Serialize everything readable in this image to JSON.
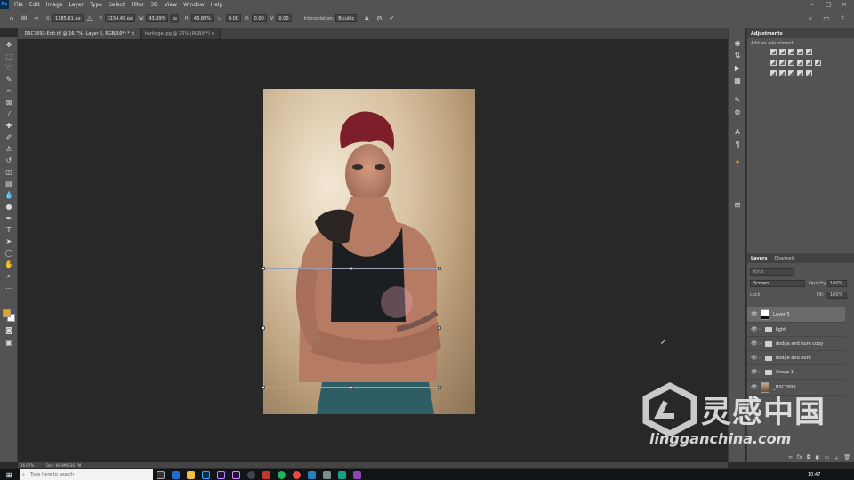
{
  "app": {
    "logo": "Ps"
  },
  "menu": [
    "File",
    "Edit",
    "Image",
    "Layer",
    "Type",
    "Select",
    "Filter",
    "3D",
    "View",
    "Window",
    "Help"
  ],
  "options": {
    "x_label": "X:",
    "x_value": "1185.61 px",
    "y_label": "Y:",
    "y_value": "3154.49 px",
    "w_label": "W:",
    "w_value": "43.89%",
    "h_label": "H:",
    "h_value": "43.89%",
    "angle_value": "0.00",
    "hskew_label": "H:",
    "hskew_value": "0.00",
    "vskew_label": "V:",
    "vskew_value": "0.00",
    "interp_label": "Interpolation:",
    "interp_value": "Bicubic"
  },
  "tabs": [
    {
      "label": "_DSC7693-Edit.tif @ 16.7% (Layer 5, RGB/16*) *",
      "active": true
    },
    {
      "label": "haritage.jpg @ 25% (RGB/8*)",
      "active": false
    }
  ],
  "adjustments": {
    "title": "Adjustments",
    "subtitle": "Add an adjustment"
  },
  "layers_panel": {
    "tabs": [
      "Layers",
      "Channels"
    ],
    "kind_placeholder": "Kind",
    "blend_mode": "Screen",
    "opacity_label": "Opacity:",
    "opacity_value": "100%",
    "lock_label": "Lock:",
    "fill_label": "Fill:",
    "fill_value": "100%",
    "layers": [
      {
        "name": "Layer 5",
        "type": "pixel",
        "selected": true
      },
      {
        "name": "light",
        "type": "group",
        "selected": false
      },
      {
        "name": "dodge and burn copy",
        "type": "group",
        "selected": false
      },
      {
        "name": "dodge and burn",
        "type": "group",
        "selected": false
      },
      {
        "name": "Group 1",
        "type": "group",
        "selected": false
      },
      {
        "name": "_DSC7693",
        "type": "pixel",
        "selected": false
      }
    ]
  },
  "status": {
    "zoom": "16.67%",
    "doc": "Doc: 69.9M/530.7M"
  },
  "taskbar": {
    "search_placeholder": "Type here to search",
    "time": "10:47"
  },
  "watermark": {
    "brand": "灵感中国",
    "url": "lingganchina.com"
  },
  "colors": {
    "accent": "#31a8ff",
    "foreground_swatch": "#e8a21f",
    "background_swatch": "#ffffff"
  }
}
